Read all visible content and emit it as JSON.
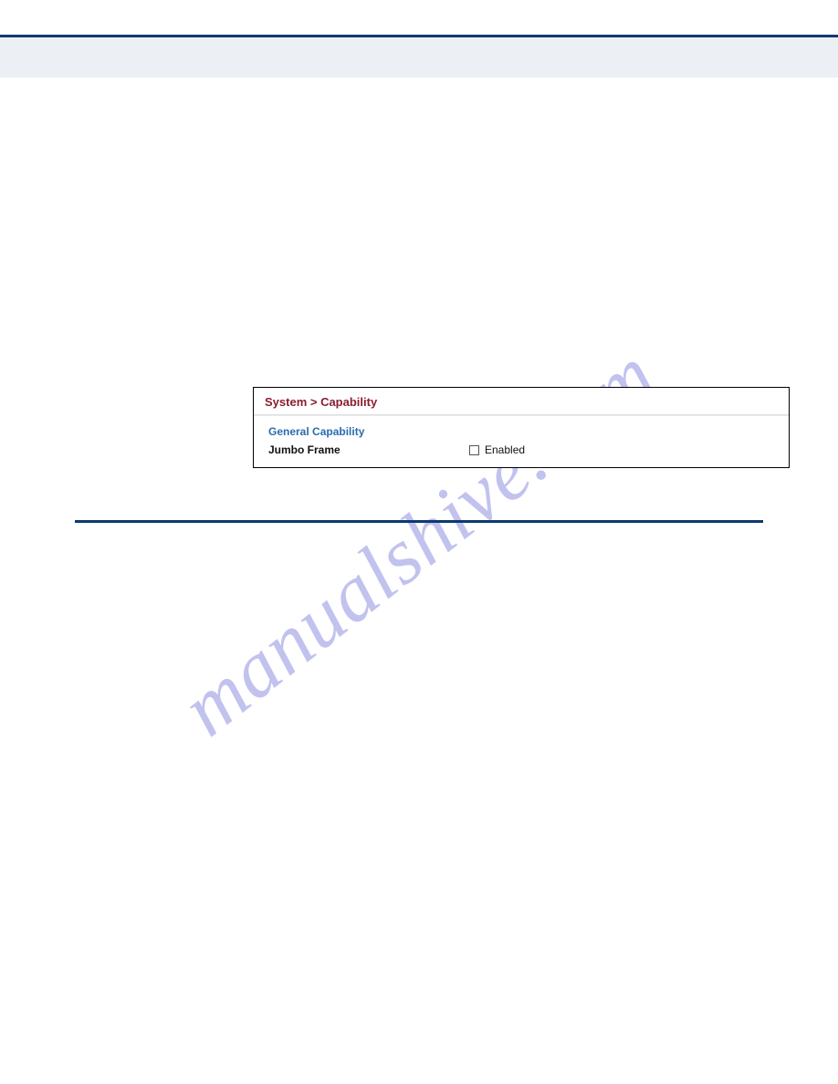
{
  "watermark": "manualshive.com",
  "panel": {
    "breadcrumb": "System > Capability",
    "section_title": "General Capability",
    "row_label": "Jumbo Frame",
    "checkbox_label": "Enabled"
  }
}
